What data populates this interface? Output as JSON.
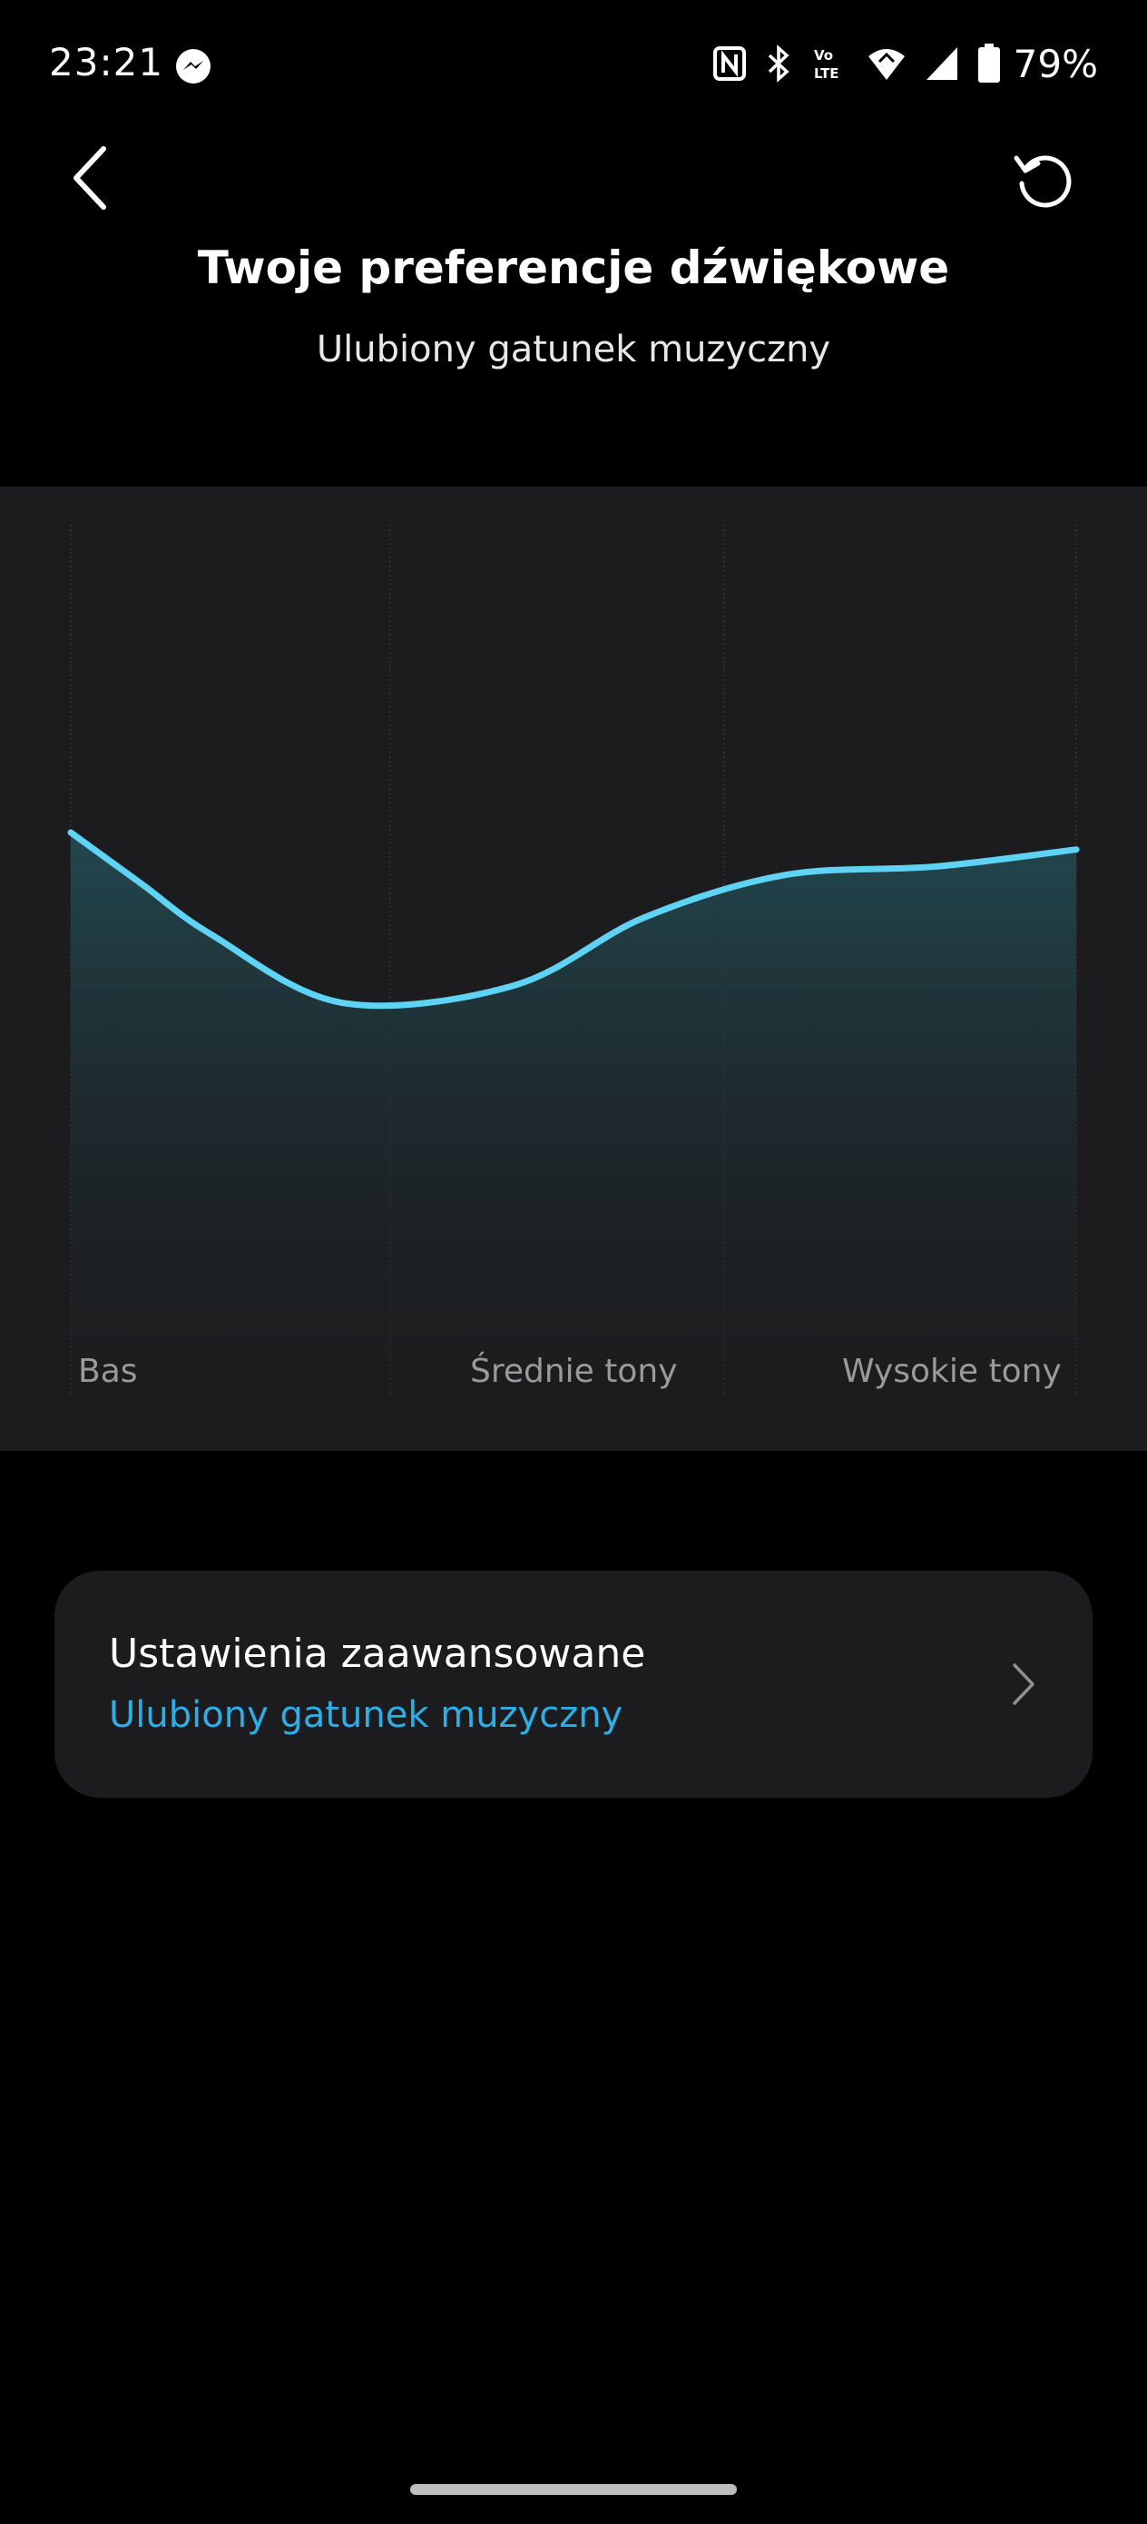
{
  "status_bar": {
    "time": "23:21",
    "battery_percent": "79%",
    "icons": [
      "messenger-icon",
      "nfc-icon",
      "bluetooth-icon",
      "volte-icon",
      "wifi-icon",
      "signal-icon",
      "battery-icon"
    ]
  },
  "header": {
    "title": "Twoje preferencje dźwiękowe",
    "subtitle": "Ulubiony gatunek muzyczny",
    "back_icon": "chevron-left-icon",
    "reset_icon": "refresh-icon"
  },
  "chart_data": {
    "type": "area",
    "band_labels": [
      "Bas",
      "Średnie tony",
      "Wysokie tony"
    ],
    "x": [
      0,
      0.07,
      0.14,
      0.27,
      0.44,
      0.57,
      0.71,
      0.86,
      1.0
    ],
    "values": [
      0.66,
      0.6,
      0.54,
      0.46,
      0.48,
      0.56,
      0.61,
      0.62,
      0.64
    ],
    "line_color": "#5fd3f3",
    "fill_color": "#1e3c42",
    "grid": true
  },
  "advanced_settings": {
    "title": "Ustawienia zaawansowane",
    "subtitle": "Ulubiony gatunek muzyczny",
    "accent_color": "#2eaee6",
    "icon": "chevron-right-icon"
  }
}
